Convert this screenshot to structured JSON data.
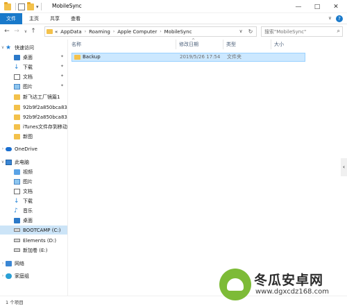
{
  "window": {
    "title": "MobileSync",
    "controls": {
      "minimize": "—",
      "maximize": "□",
      "close": "✕"
    }
  },
  "ribbon": {
    "tabs": [
      "文件",
      "主页",
      "共享",
      "查看"
    ],
    "expand": "∨"
  },
  "navigation": {
    "back": "←",
    "forward": "→",
    "recent": "∨",
    "up": "↑",
    "breadcrumb": [
      "«",
      "AppData",
      "Roaming",
      "Apple Computer",
      "MobileSync"
    ],
    "separator": "›",
    "search_placeholder": "搜索\"MobileSync\""
  },
  "sidebar": {
    "items": [
      {
        "label": "快速访问",
        "icon": "star-icon"
      },
      {
        "label": "桌面",
        "icon": "desktop-icon",
        "pinned": true
      },
      {
        "label": "下载",
        "icon": "download-icon",
        "pinned": true
      },
      {
        "label": "文档",
        "icon": "document-icon",
        "pinned": true
      },
      {
        "label": "图片",
        "icon": "picture-icon",
        "pinned": true
      },
      {
        "label": "新飞达工厂镜篇1",
        "icon": "folder-icon"
      },
      {
        "label": "92b9f2a850bca83",
        "icon": "folder-icon"
      },
      {
        "label": "92b9f2a850bca83",
        "icon": "folder-icon"
      },
      {
        "label": "iTunes文件存到移动",
        "icon": "folder-icon"
      },
      {
        "label": "新图",
        "icon": "folder-icon"
      },
      {
        "label": "OneDrive",
        "icon": "cloud-icon"
      },
      {
        "label": "此电脑",
        "icon": "pc-icon"
      },
      {
        "label": "视频",
        "icon": "video-icon"
      },
      {
        "label": "图片",
        "icon": "picture-icon"
      },
      {
        "label": "文档",
        "icon": "document-icon"
      },
      {
        "label": "下载",
        "icon": "download-icon"
      },
      {
        "label": "音乐",
        "icon": "music-icon"
      },
      {
        "label": "桌面",
        "icon": "desktop-icon"
      },
      {
        "label": "BOOTCAMP (C:)",
        "icon": "drive-icon",
        "selected": true
      },
      {
        "label": "Elements (D:)",
        "icon": "drive-icon"
      },
      {
        "label": "新加卷 (E:)",
        "icon": "drive-icon"
      },
      {
        "label": "网络",
        "icon": "network-icon"
      },
      {
        "label": "家庭组",
        "icon": "homegroup-icon"
      }
    ]
  },
  "file_list": {
    "columns": [
      "名称",
      "修改日期",
      "类型",
      "大小"
    ],
    "rows": [
      {
        "name": "Backup",
        "modified": "2019/5/26 17:54",
        "type": "文件夹",
        "size": ""
      }
    ]
  },
  "status": {
    "item_count": "1 个项目"
  },
  "watermark": {
    "title": "冬瓜安卓网",
    "url": "www.dgxcdz168.com"
  },
  "colors": {
    "accent": "#1979ca",
    "selection": "#cce8ff",
    "watermark_logo": "#7dbb37"
  }
}
